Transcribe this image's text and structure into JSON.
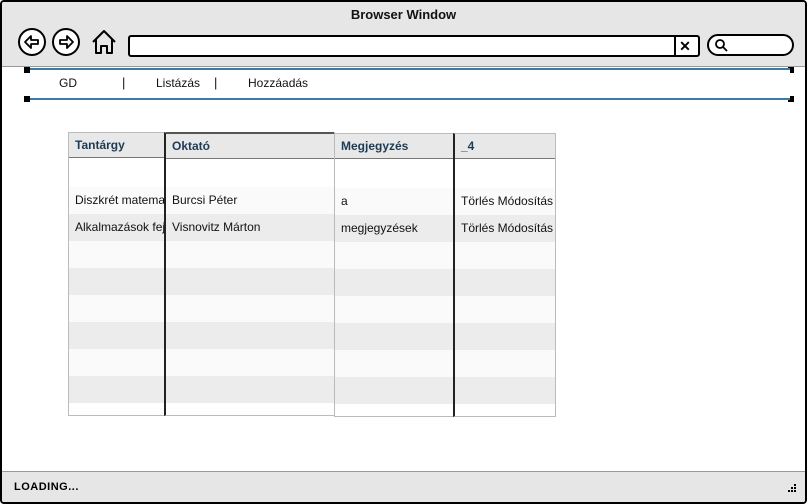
{
  "window": {
    "title": "Browser Window"
  },
  "nav": {
    "url_value": "",
    "search_value": ""
  },
  "tabs": {
    "items": [
      "GD",
      "Listázás",
      "Hozzáadás"
    ],
    "separator": "|"
  },
  "table": {
    "headers": [
      "Tantárgy",
      "Oktató",
      "Megjegyzés",
      "_4"
    ],
    "rows": [
      [
        "Diszkrét matemat",
        "Burcsi Péter",
        "a",
        "Törlés Módosítás"
      ],
      [
        "Alkalmazások fejle",
        "Visnovitz Márton",
        "megjegyzések",
        "Törlés Módosítás"
      ]
    ]
  },
  "status": {
    "text": "LOADING..."
  },
  "colors": {
    "frame": "#000000",
    "chrome": "#e6e6e6",
    "tab_border": "#3a7ca5",
    "header_text": "#1d3b55"
  }
}
